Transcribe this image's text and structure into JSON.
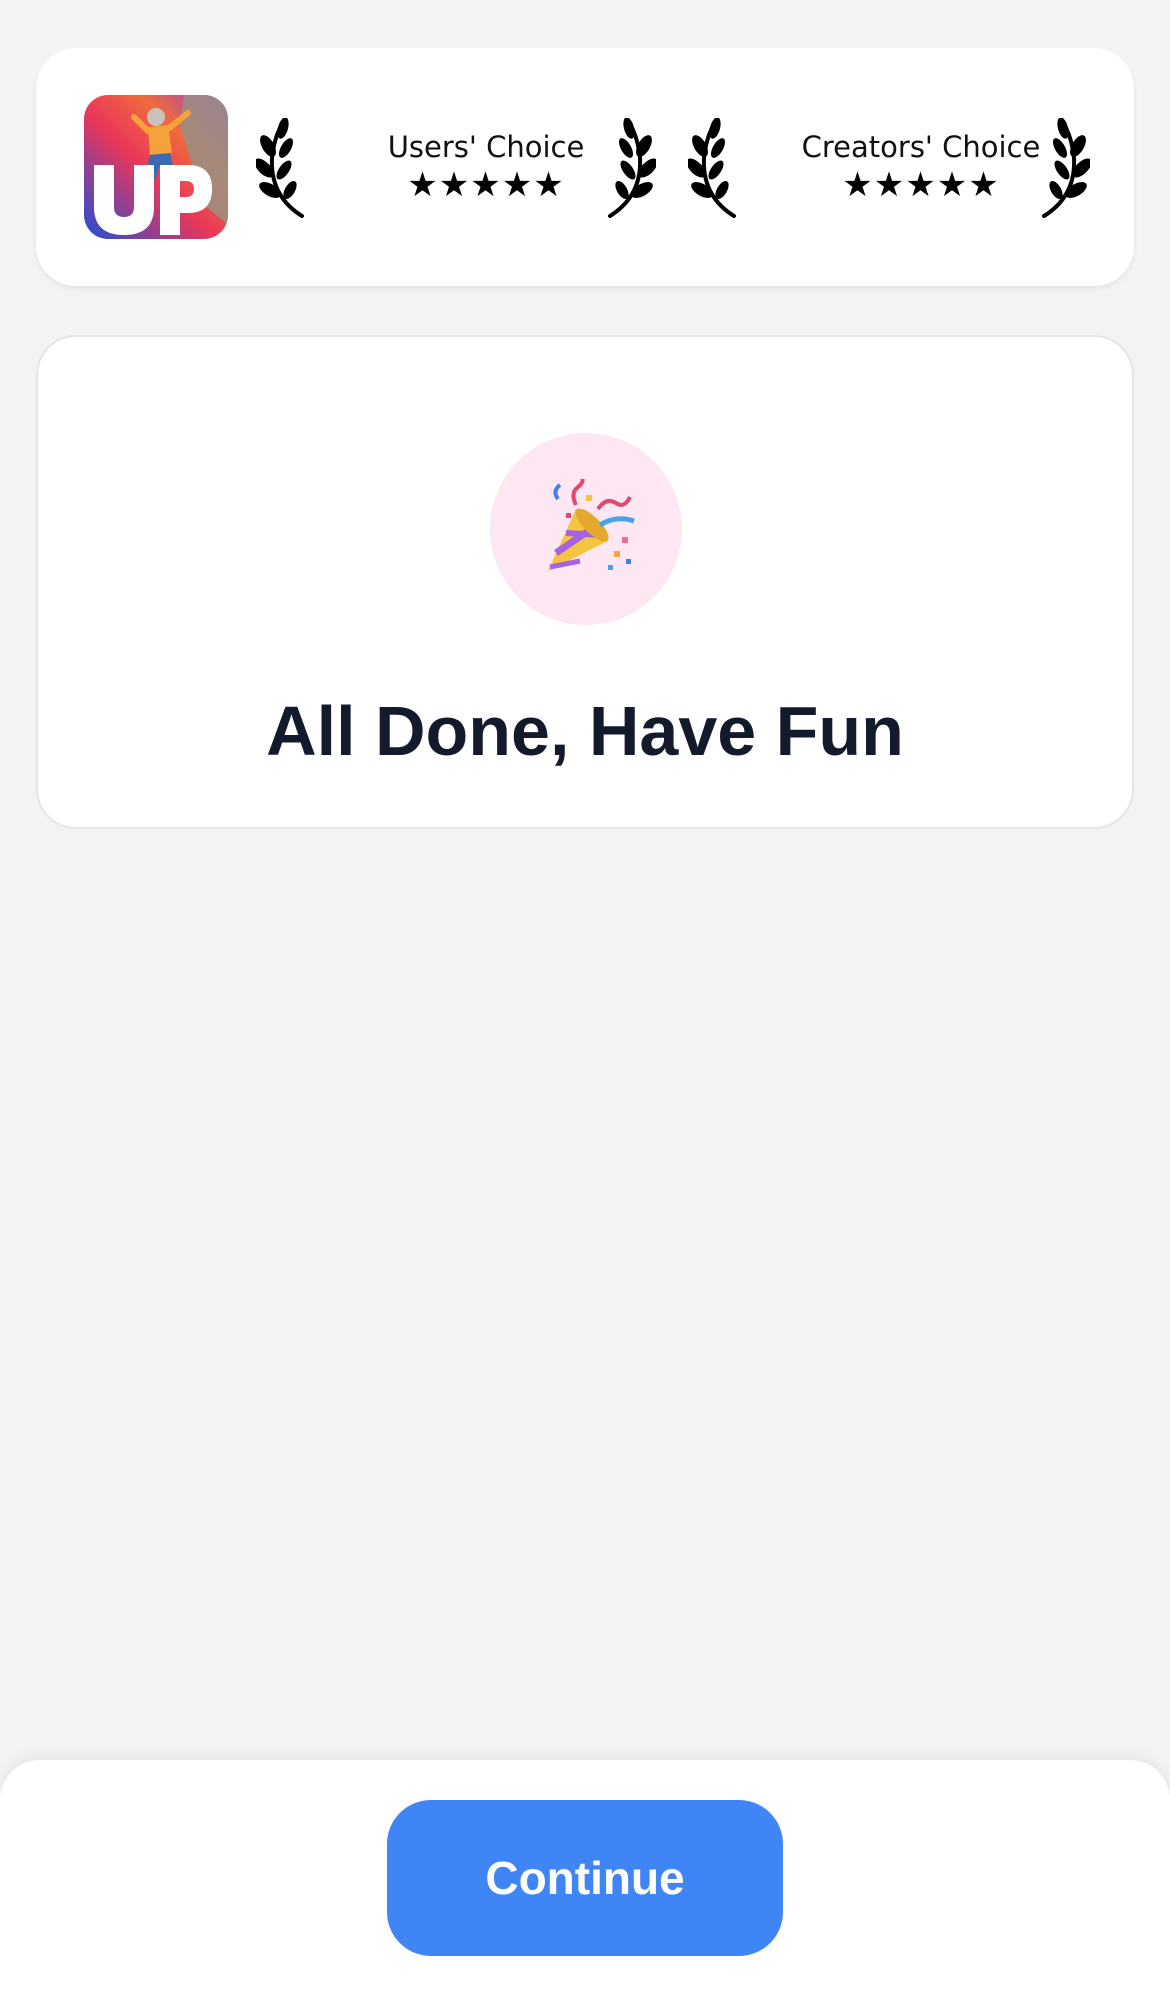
{
  "awards": [
    {
      "title": "Users' Choice",
      "stars": "★★★★★",
      "rating": 5
    },
    {
      "title": "Creators' Choice",
      "stars": "★★★★★",
      "rating": 5
    }
  ],
  "logo": {
    "icon": "up-app-logo-icon"
  },
  "done": {
    "icon": "party-popper-icon",
    "title": "All Done, Have Fun"
  },
  "footer": {
    "continue_label": "Continue"
  },
  "colors": {
    "background": "#f2f3f5",
    "card": "#ffffff",
    "accent_button": "#3f85f5",
    "icon_circle": "#fce7f3",
    "title_text": "#131a2c"
  }
}
